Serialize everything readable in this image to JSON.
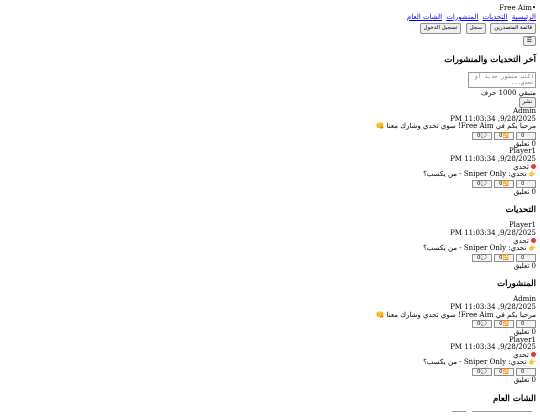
{
  "app": {
    "brand": "•Free Aim"
  },
  "nav": {
    "items": [
      "الرئيسية",
      "التحديات",
      "المنشورات",
      "الشات العام"
    ]
  },
  "auth": {
    "login_label": "تسجيل الدخول",
    "signup_label": "سجل",
    "leaderboard_label": "قائمة المتصدرين"
  },
  "menu_icon": "menu-icon",
  "feed": {
    "title": "آخر التحديات والمنشورات",
    "composer_placeholder": "اكتب منشور جديد أو تحدي...",
    "char_hint": "متبقي 1000 حرف",
    "publish_label": "نشر",
    "posts": [
      {
        "author": "Admin",
        "date": "9/28/2025, 11:03:34 PM",
        "body": "مرحبا بكم في Free Aim! سوي تحدي وشارك معنا 👊",
        "likes": "0",
        "reposts": "0",
        "comments_count": "0",
        "comments_label": "0 تعليق"
      },
      {
        "author": "Player1",
        "date": "9/28/2025, 11:03:34 PM",
        "tag": "تحدي",
        "body": "تحدي: Sniper Only - من يكسب؟",
        "likes": "0",
        "reposts": "0",
        "comments_count": "0",
        "comments_label": "0 تعليق"
      }
    ]
  },
  "challenges": {
    "title": "التحديات",
    "posts": [
      {
        "author": "Player1",
        "date": "9/28/2025, 11:03:34 PM",
        "tag": "تحدي",
        "body": "تحدي: Sniper Only - من يكسب؟",
        "likes": "0",
        "reposts": "0",
        "comments_count": "0",
        "comments_label": "0 تعليق"
      }
    ]
  },
  "posts_section": {
    "title": "المنشورات",
    "posts": [
      {
        "author": "Admin",
        "date": "9/28/2025, 11:03:34 PM",
        "body": "مرحبا بكم في Free Aim! سوي تحدي وشارك معنا 👊",
        "likes": "0",
        "reposts": "0",
        "comments_count": "0",
        "comments_label": "0 تعليق"
      },
      {
        "author": "Player1",
        "date": "9/28/2025, 11:03:34 PM",
        "tag": "تحدي",
        "body": "تحدي: Sniper Only - من يكسب؟",
        "likes": "0",
        "reposts": "0",
        "comments_count": "0",
        "comments_label": "0 تعليق"
      }
    ]
  },
  "chat": {
    "title": "الشات العام"
  }
}
